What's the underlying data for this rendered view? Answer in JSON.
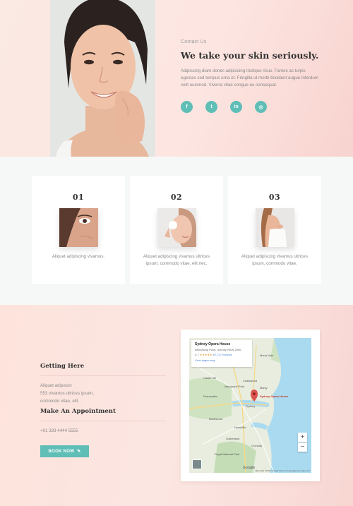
{
  "hero": {
    "eyebrow": "Contact Us",
    "title": "We take your skin seriously.",
    "body": "Adipiscing diam donec adipiscing tristique risus. Fames ac turpis egestas sed tempus urna et. Fringilla ut morbi tincidunt augue interdum velit euismod. Viverra vitae congue eu consequat.",
    "socials": [
      {
        "icon": "facebook-icon",
        "glyph": "f"
      },
      {
        "icon": "twitter-icon",
        "glyph": "t"
      },
      {
        "icon": "linkedin-icon",
        "glyph": "in"
      },
      {
        "icon": "instagram-icon",
        "glyph": "◎"
      }
    ]
  },
  "features": [
    {
      "num": "01",
      "caption": "Aliquet adipiscing vivamus."
    },
    {
      "num": "02",
      "caption": "Aliquet adipiscing vivamus ultrices ipsum, commodo vitae, elit nec."
    },
    {
      "num": "03",
      "caption": "Aliquet adipiscing vivamus ultrices ipsum, commodo vitae."
    }
  ],
  "contact": {
    "getting_here_title": "Getting Here",
    "address_line1": "Aliquet adipiscin",
    "address_line2": "553 vivamus ultrices ipsum,",
    "address_line3": "commodo vitae, elit",
    "appointment_title": "Make An Appointment",
    "phone": "+01 333 4444 5555",
    "book_label": "BOOK NOW",
    "book_icon": "edit-icon"
  },
  "map": {
    "place_name": "Sydney Opera House",
    "place_address": "Bennelong Point, Sydney NSW 2000",
    "rating": "4.7",
    "stars": "★★★★★",
    "reviews": "67,727 reviews",
    "view_larger": "View larger map",
    "pin_label": "Sydney Opera House",
    "labels": [
      "Castle Hill",
      "Parramatta",
      "Macquarie Park",
      "Chatswood",
      "Sydney",
      "Bankstown",
      "Hurstville",
      "Sutherland",
      "Royal National Park",
      "Manly",
      "Mona Vale",
      "Cronulla"
    ],
    "zoom_in": "+",
    "zoom_out": "−",
    "google": "Google",
    "attribution": "Map data ©2019 Google   Terms of Use   Report a map error"
  },
  "colors": {
    "accent": "#5fbeb6",
    "hero_bg": "#fde6e2",
    "features_bg": "#f5f8f7"
  }
}
